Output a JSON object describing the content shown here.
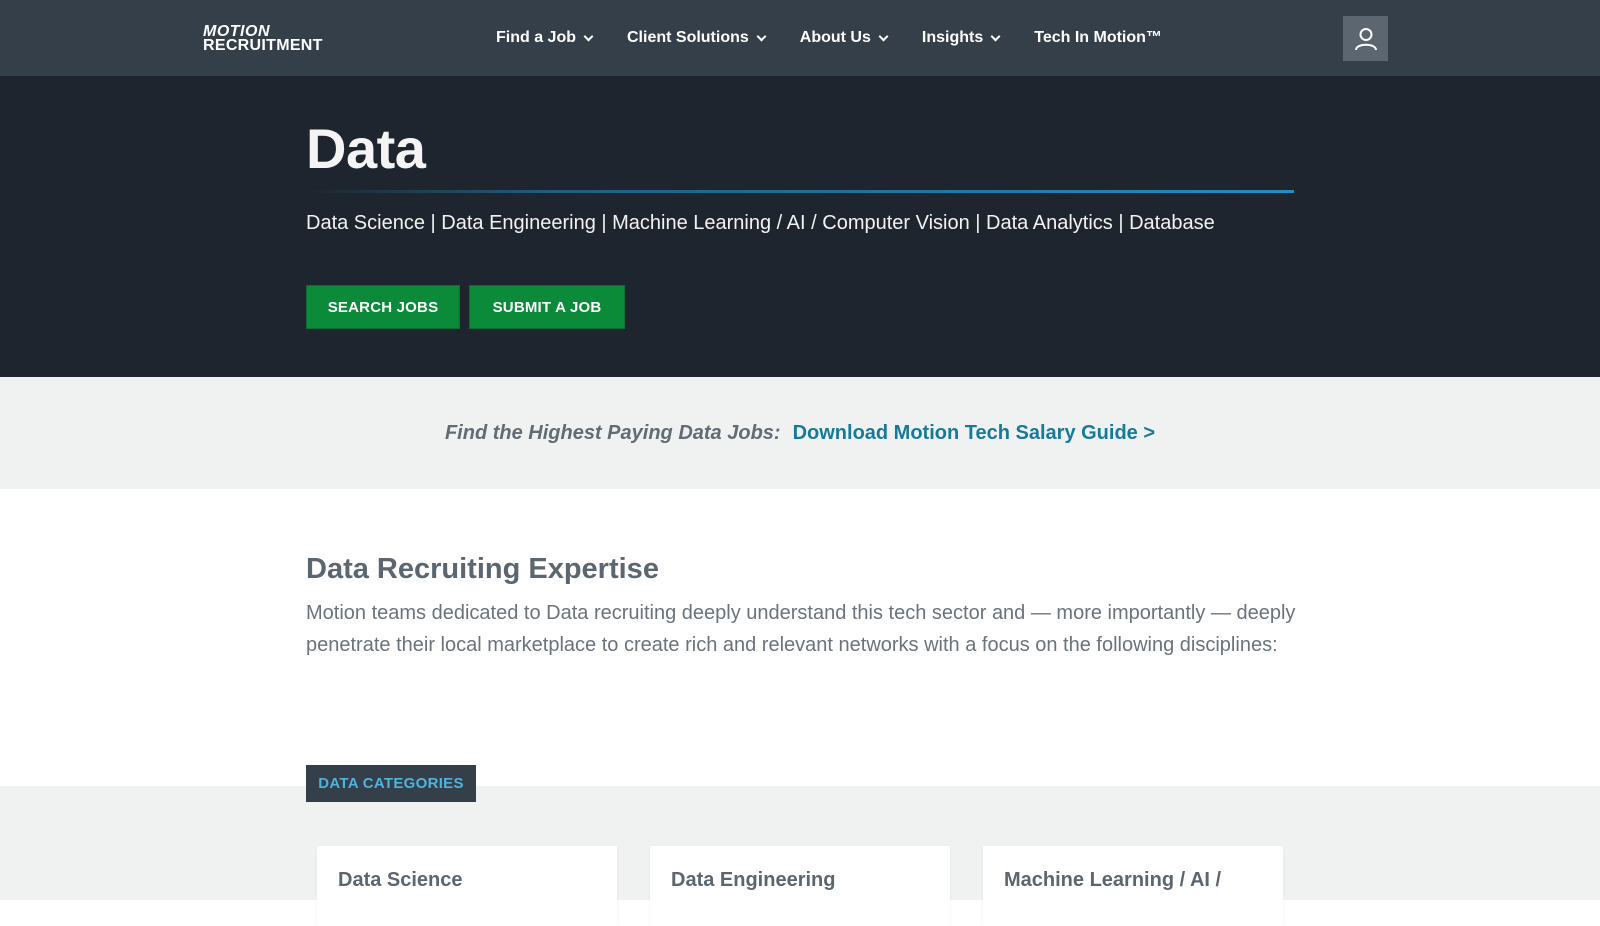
{
  "header": {
    "logo_line1": "MOTION",
    "logo_line2": "RECRUITMENT",
    "nav": [
      {
        "label": "Find a Job",
        "has_dropdown": true
      },
      {
        "label": "Client Solutions",
        "has_dropdown": true
      },
      {
        "label": "About Us",
        "has_dropdown": true
      },
      {
        "label": "Insights",
        "has_dropdown": true
      },
      {
        "label": "Tech In Motion™",
        "has_dropdown": false
      }
    ],
    "user_icon": "user-icon"
  },
  "hero": {
    "title": "Data",
    "subtitle": "Data Science | Data Engineering | Machine Learning / AI / Computer Vision | Data Analytics | Database",
    "search_label": "SEARCH JOBS",
    "submit_label": "SUBMIT A JOB"
  },
  "banner": {
    "question": "Find the Highest Paying Data Jobs:",
    "link": "Download Motion Tech Salary Guide >"
  },
  "expertise": {
    "title": "Data Recruiting Expertise",
    "text": "Motion teams dedicated to Data recruiting deeply understand this tech sector and — more importantly — deeply penetrate their local marketplace to create rich and relevant networks with a focus on the following disciplines:"
  },
  "categories": {
    "tag": "DATA CATEGORIES",
    "cards": [
      {
        "title": "Data Science"
      },
      {
        "title": "Data Engineering"
      },
      {
        "title": "Machine Learning / AI /"
      }
    ]
  },
  "colors": {
    "header_bg": "#343f4a",
    "hero_bg": "#1f252e",
    "button_green": "#0b8a3a",
    "link_blue": "#187a9a",
    "tag_text": "#4fb3de"
  }
}
